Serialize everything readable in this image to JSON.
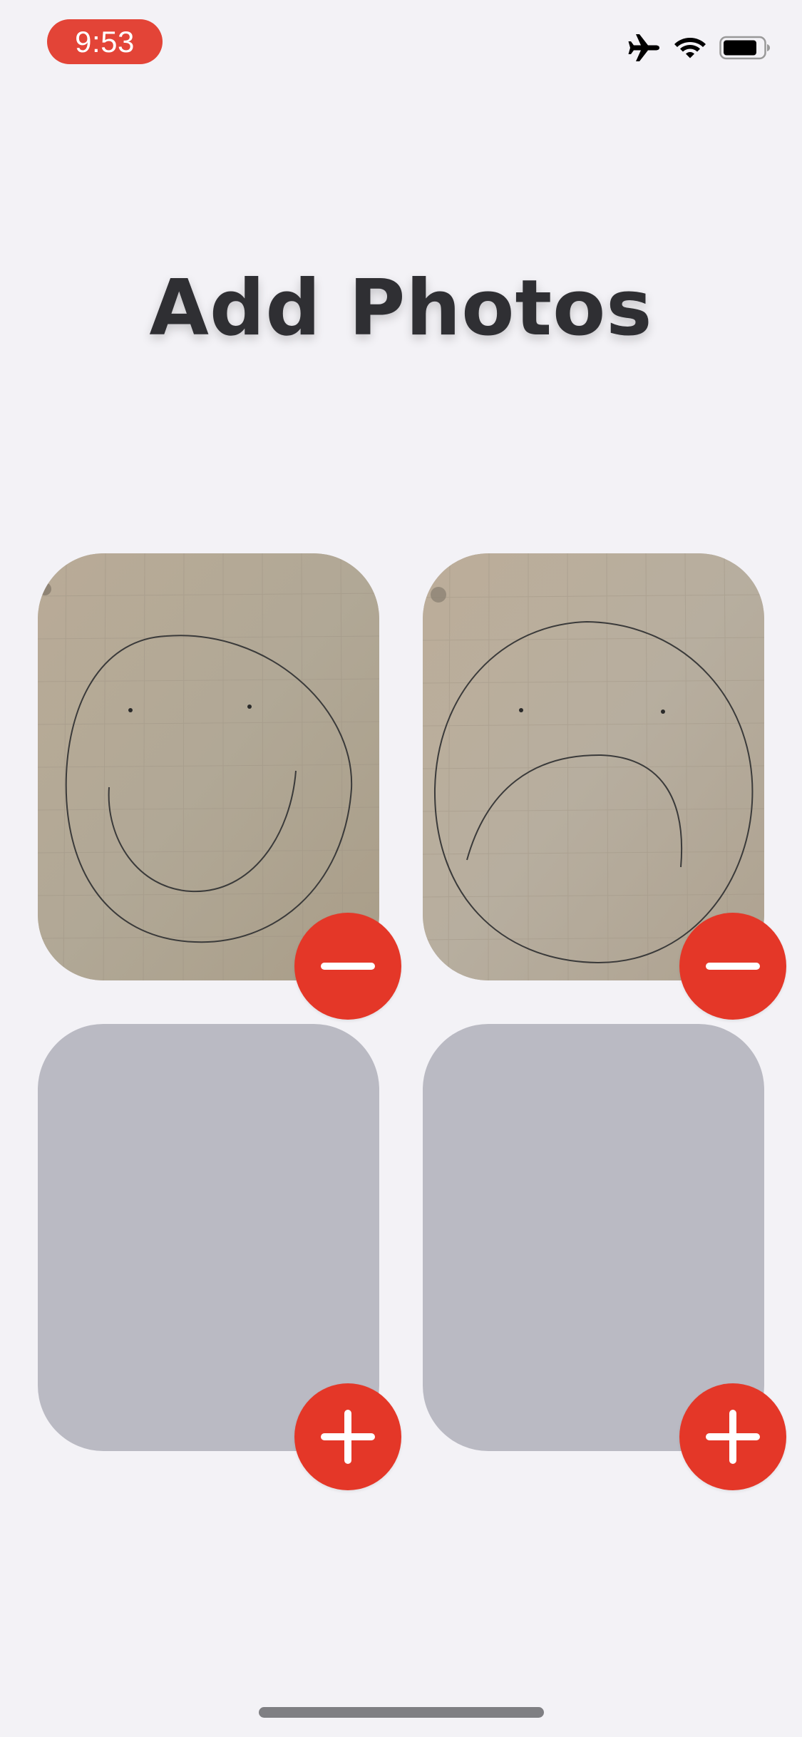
{
  "status_bar": {
    "time": "9:53",
    "accent_color": "#e34437",
    "icons": [
      "airplane-mode-icon",
      "wifi-icon",
      "battery-icon"
    ]
  },
  "title": "Add Photos",
  "photo_slots": [
    {
      "state": "filled",
      "content": "smiley-face-drawing",
      "action_icon": "minus-icon"
    },
    {
      "state": "filled",
      "content": "frowning-face-drawing",
      "action_icon": "minus-icon"
    },
    {
      "state": "empty",
      "action_icon": "plus-icon"
    },
    {
      "state": "empty",
      "action_icon": "plus-icon"
    }
  ],
  "colors": {
    "background": "#f3f2f6",
    "empty_slot": "#babac3",
    "action_button": "#e43728",
    "title_text": "#2f2f33"
  }
}
